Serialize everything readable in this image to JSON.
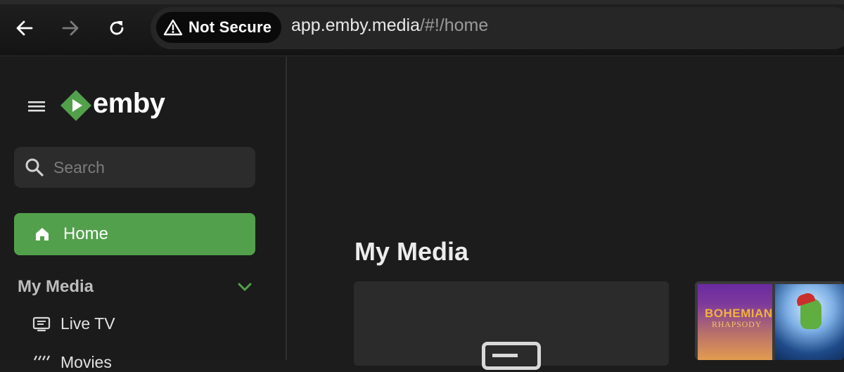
{
  "browser": {
    "security_label": "Not Secure",
    "url_host": "app.emby.media",
    "url_path": "/#!/home"
  },
  "sidebar": {
    "logo_text": "emby",
    "search_placeholder": "Search",
    "home_label": "Home",
    "section_title": "My Media",
    "items": [
      {
        "label": "Live TV"
      },
      {
        "label": "Movies"
      }
    ]
  },
  "main": {
    "title": "My Media",
    "poster_title_line1": "BOHEMIAN",
    "poster_title_line2": "RHAPSODY"
  },
  "colors": {
    "accent": "#52a04b",
    "background": "#1c1c1c",
    "chrome": "#1a1a1a"
  }
}
